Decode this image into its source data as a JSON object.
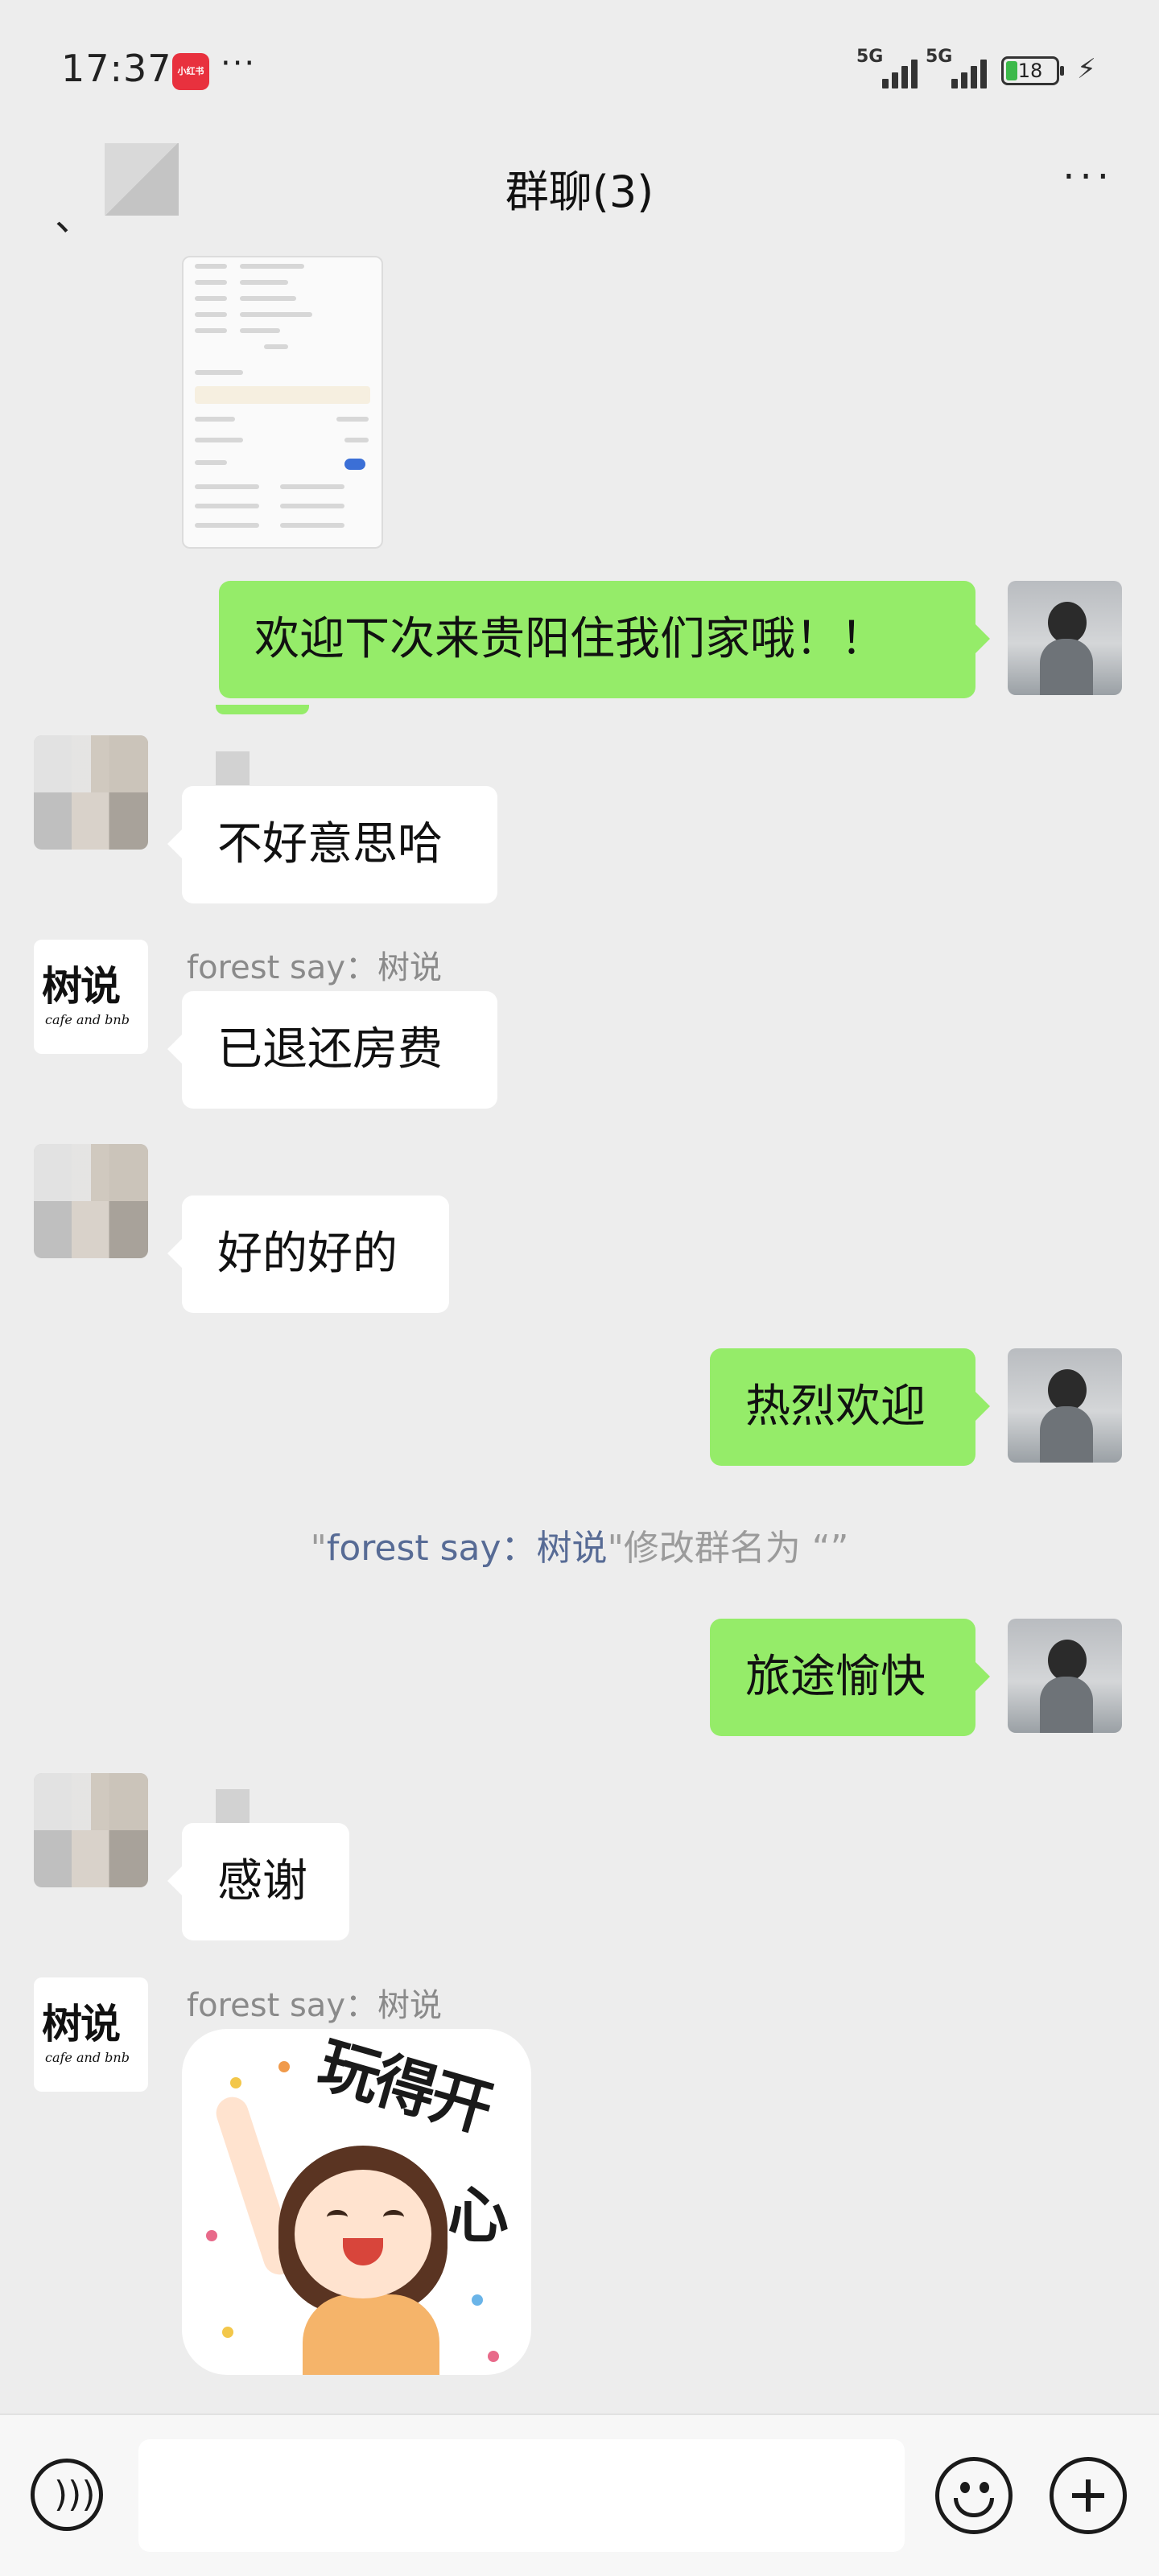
{
  "status_bar": {
    "time": "17:37",
    "app_badge": "小红书",
    "more_dots": "···",
    "signal1": "5G",
    "signal2": "5G",
    "battery": "18"
  },
  "nav": {
    "back": "、",
    "title": "群聊(3)",
    "more": "···"
  },
  "messages": [
    {
      "side": "out",
      "type": "image",
      "desc": "screenshot"
    },
    {
      "side": "out",
      "text": "欢迎下次来贵阳住我们家哦！！"
    },
    {
      "side": "in",
      "text": "不好意思哈"
    },
    {
      "side": "in",
      "sender": "forest say：树说",
      "text": "已退还房费"
    },
    {
      "side": "in",
      "text": "好的好的"
    },
    {
      "side": "out",
      "text": "热烈欢迎"
    },
    {
      "side": "out",
      "text": "旅途愉快"
    },
    {
      "side": "in",
      "text": "感谢"
    },
    {
      "side": "in",
      "sender": "forest say：树说",
      "type": "sticker",
      "sticker_text": "玩得开心"
    }
  ],
  "system_message": {
    "quote_open": "\"",
    "name": "forest say：树说",
    "quote_close": "\"",
    "action": "修改群名为 “”"
  },
  "avatar_tree": {
    "title": "树说",
    "sub": "cafe and bnb"
  },
  "sticker": {
    "line1": "玩得开",
    "line2": "心"
  },
  "input_bar": {
    "value": ""
  },
  "colors": {
    "background": "#ededed",
    "outgoing_bubble": "#95ec69",
    "incoming_bubble": "#ffffff",
    "link_name": "#576b95"
  }
}
